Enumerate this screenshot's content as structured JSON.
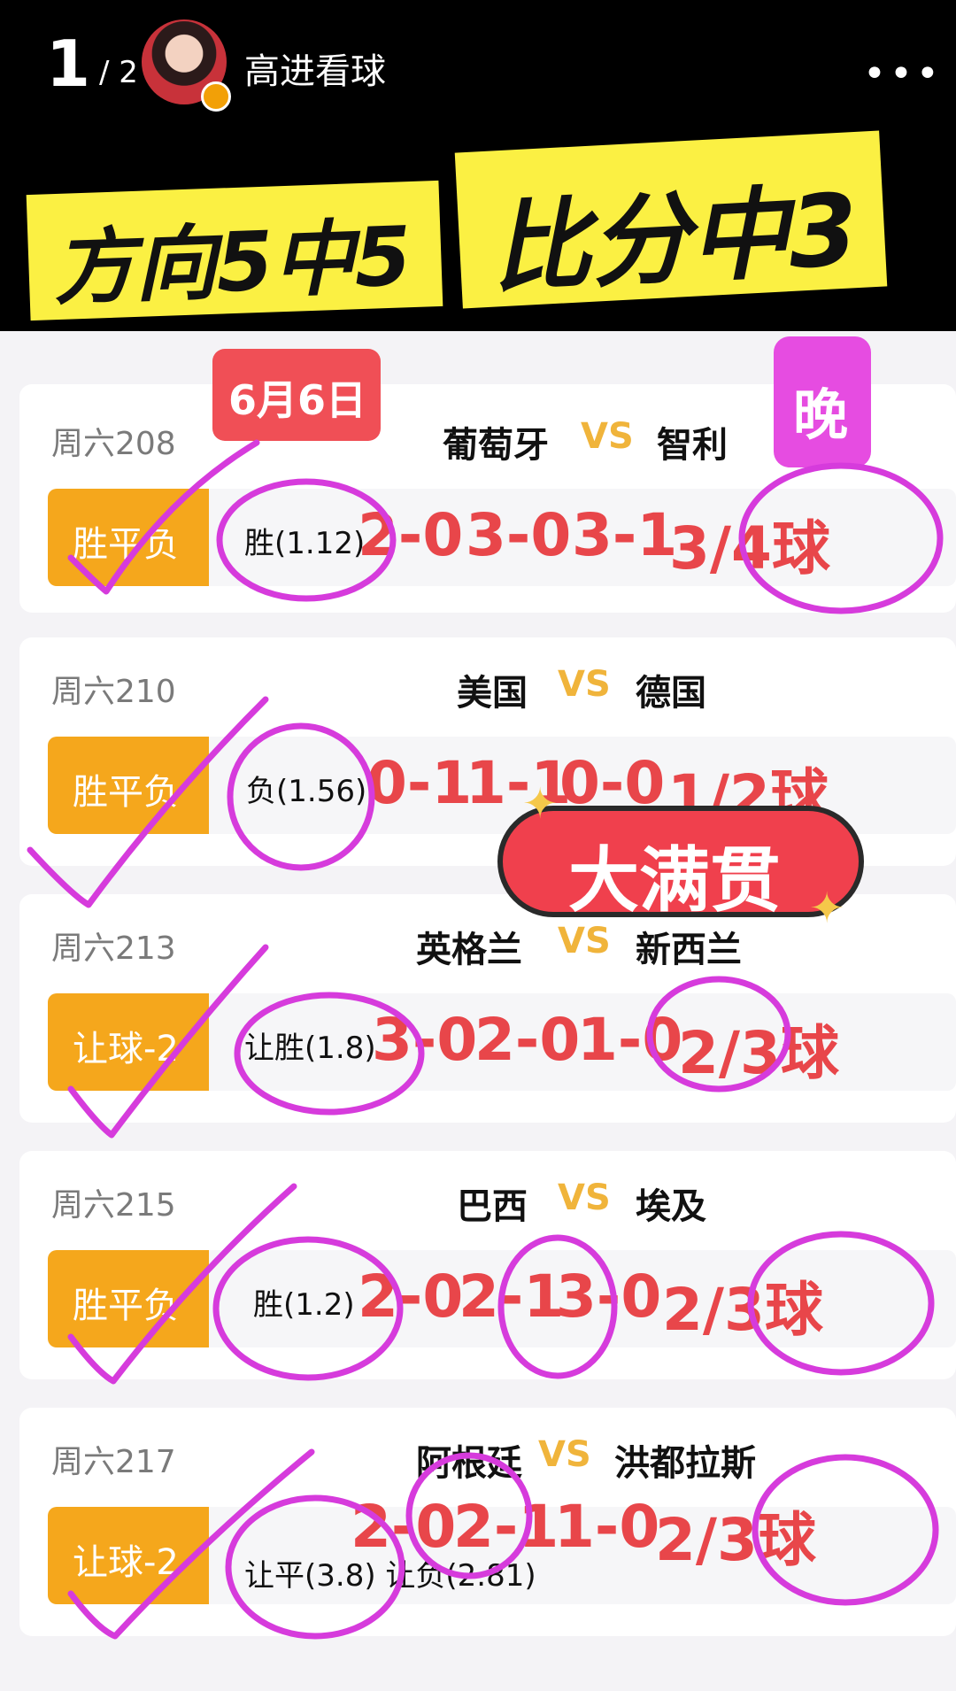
{
  "header": {
    "page_current": "1",
    "page_total": "/ 2",
    "author": "高进看球",
    "more": "•••"
  },
  "banner": {
    "left": "方向5中5",
    "right": "比分中3"
  },
  "tags": {
    "date": "6月6日",
    "night": "晚",
    "slam": "大满贯"
  },
  "matches": [
    {
      "week": "周六208",
      "home": "葡萄牙",
      "vs": "VS",
      "away": "智利",
      "type": "胜平负",
      "pick": "胜(1.12)",
      "scores": [
        "2-0",
        "3-0",
        "3-1",
        "3/4球"
      ]
    },
    {
      "week": "周六210",
      "home": "美国",
      "vs": "VS",
      "away": "德国",
      "type": "胜平负",
      "pick": "负(1.56)",
      "scores": [
        "0-1",
        "1-1",
        "0-0",
        "1/2球"
      ]
    },
    {
      "week": "周六213",
      "home": "英格兰",
      "vs": "VS",
      "away": "新西兰",
      "type": "让球-2",
      "pick": "让胜(1.8)",
      "scores": [
        "3-0",
        "2-0",
        "1-0",
        "2/3球"
      ]
    },
    {
      "week": "周六215",
      "home": "巴西",
      "vs": "VS",
      "away": "埃及",
      "type": "胜平负",
      "pick": "胜(1.2)",
      "scores": [
        "2-0",
        "2-1",
        "3-0",
        "2/3球"
      ]
    },
    {
      "week": "周六217",
      "home": "阿根廷",
      "vs": "VS",
      "away": "洪都拉斯",
      "type": "让球-2",
      "pick": "让平(3.8) 让负(2.81)",
      "scores": [
        "2-0",
        "2-1",
        "1-0",
        "2/3球"
      ]
    }
  ],
  "colors": {
    "banner_yellow": "#fbf043",
    "score_red": "#e8464a",
    "pill_orange": "#f5a71c",
    "mark_magenta": "#d63bdc"
  }
}
